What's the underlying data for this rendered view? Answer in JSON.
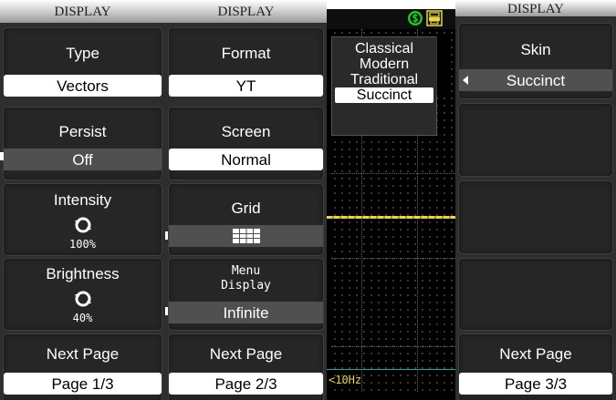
{
  "panel1": {
    "header": "DISPLAY",
    "type": {
      "label": "Type",
      "value": "Vectors"
    },
    "persist": {
      "label": "Persist",
      "value": "Off"
    },
    "intensity": {
      "label": "Intensity",
      "value": "100%",
      "level": 1.0
    },
    "brightness": {
      "label": "Brightness",
      "value": "40%",
      "level": 0.4
    },
    "next": {
      "label": "Next Page",
      "value": "Page 1/3"
    }
  },
  "panel2": {
    "header": "DISPLAY",
    "format": {
      "label": "Format",
      "value": "YT"
    },
    "screen": {
      "label": "Screen",
      "value": "Normal"
    },
    "grid": {
      "label": "Grid",
      "icon": "grid-icon"
    },
    "menu_display": {
      "label_line1": "Menu",
      "label_line2": "Display",
      "value": "Infinite"
    },
    "next": {
      "label": "Next Page",
      "value": "Page 2/3"
    }
  },
  "screen": {
    "skin_options": [
      "Classical",
      "Modern",
      "Traditional",
      "Succinct"
    ],
    "selected_skin": "Succinct",
    "frequency": "<10Hz",
    "icons": [
      "dollar-circle-icon",
      "printer-icon"
    ],
    "colors": {
      "trace": "#e8d83a",
      "icon_green": "#1ec81e",
      "icon_yellow": "#e8d83a",
      "freq_line": "#1fa8a8"
    }
  },
  "panel4": {
    "header": "DISPLAY",
    "skin": {
      "label": "Skin",
      "value": "Succinct"
    },
    "next": {
      "label": "Next Page",
      "value": "Page 3/3"
    }
  }
}
